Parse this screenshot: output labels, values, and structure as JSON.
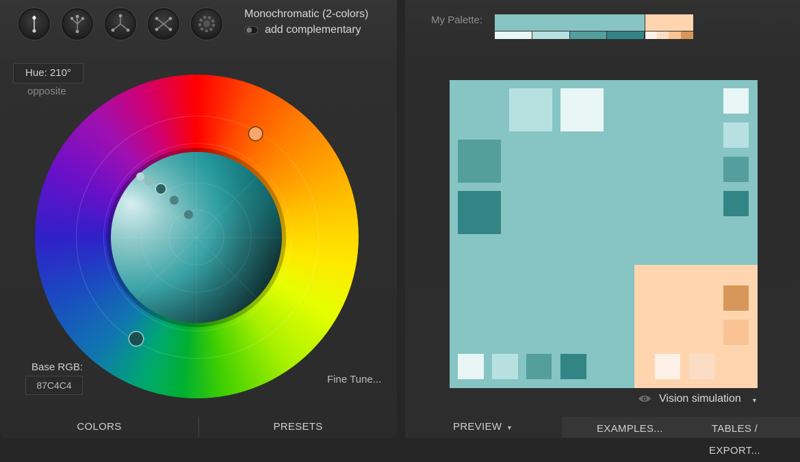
{
  "scheme_buttons": [
    {
      "name": "mono-scheme-icon"
    },
    {
      "name": "complement-scheme-icon"
    },
    {
      "name": "triad-scheme-icon"
    },
    {
      "name": "tetrad-scheme-icon"
    },
    {
      "name": "free-scheme-icon"
    }
  ],
  "mode": {
    "title": "Monochromatic (2-colors)",
    "toggle_label": "add complementary"
  },
  "hue": {
    "value": "Hue: 210°",
    "sub": "opposite"
  },
  "base": {
    "label": "Base RGB:",
    "value": "87C4C4"
  },
  "fine_tune": "Fine Tune...",
  "left_tabs": {
    "colors": "COLORS",
    "presets": "PRESETS"
  },
  "palette": {
    "label": "My Palette:",
    "main_colors": [
      "#87c4c4",
      "#ffd5b0"
    ],
    "teal_shades": [
      "#e8f6f6",
      "#b7e1e1",
      "#549e9e",
      "#338585"
    ],
    "peach_shades": [
      "#fdf0e6",
      "#faddc4",
      "#f9c393",
      "#d7965a"
    ]
  },
  "vision": {
    "label": "Vision simulation",
    "icon": "eye-icon"
  },
  "right_tabs": {
    "preview": "PREVIEW",
    "examples": "EXAMPLES...",
    "tables": "TABLES / EXPORT..."
  },
  "colors": {
    "bg": "#262626",
    "primary": "#87c4c4",
    "complement": "#ffd5b0",
    "handle_complement": "#f7a86a",
    "handle_primary": "#1c4f51"
  }
}
